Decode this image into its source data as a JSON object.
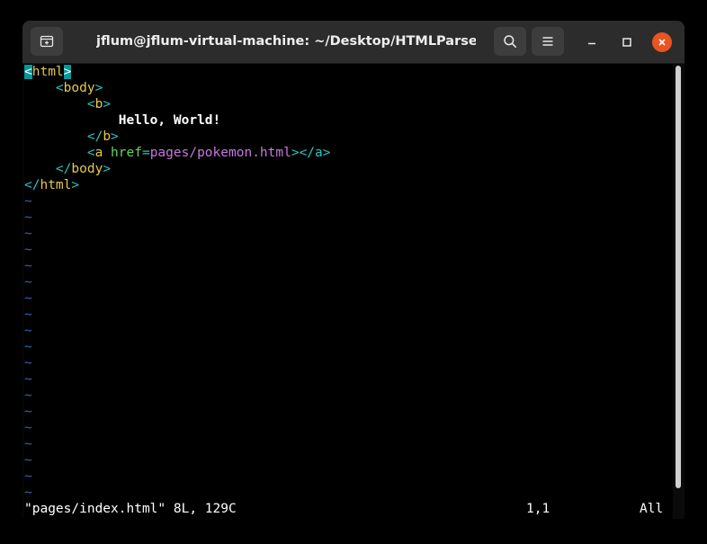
{
  "window": {
    "title": "jflum@jflum-virtual-machine: ~/Desktop/HTMLParseCrawl"
  },
  "titlebar": {
    "new_tab_icon": "new-tab-icon",
    "search_icon": "search-icon",
    "menu_icon": "hamburger-menu-icon",
    "minimize_icon": "minimize-icon",
    "maximize_icon": "maximize-icon",
    "close_icon": "close-icon"
  },
  "editor": {
    "lines": [
      {
        "indent": "",
        "open": "<",
        "tag": "html",
        "close": ">"
      },
      {
        "indent": "    ",
        "open": "<",
        "tag": "body",
        "close": ">"
      },
      {
        "indent": "        ",
        "open": "<",
        "tag": "b",
        "close": ">"
      },
      {
        "indent": "            ",
        "text": "Hello, World!"
      },
      {
        "indent": "        ",
        "open": "</",
        "tag": "b",
        "close": ">"
      },
      {
        "indent": "        ",
        "open": "<",
        "tag": "a",
        "attr_name": "href",
        "eq": "=",
        "attr_value": "pages/pokemon.html",
        "close": ">",
        "end": "</a>"
      },
      {
        "indent": "    ",
        "open": "</",
        "tag": "body",
        "close": ">"
      },
      {
        "indent": "",
        "open": "</",
        "tag": "html",
        "close": ">"
      }
    ],
    "empty_line_marker": "~",
    "empty_line_count": 19
  },
  "statusline": {
    "file_info": "\"pages/index.html\" 8L, 129C",
    "position": "1,1",
    "scroll": "All"
  },
  "colors": {
    "tag": "#2ac3c3",
    "tag_name": "#e6c84a",
    "attr": "#5fd75f",
    "value": "#c678dd",
    "tilde": "#3465a4",
    "cursor": "#06989a",
    "close_button": "#e95420"
  }
}
